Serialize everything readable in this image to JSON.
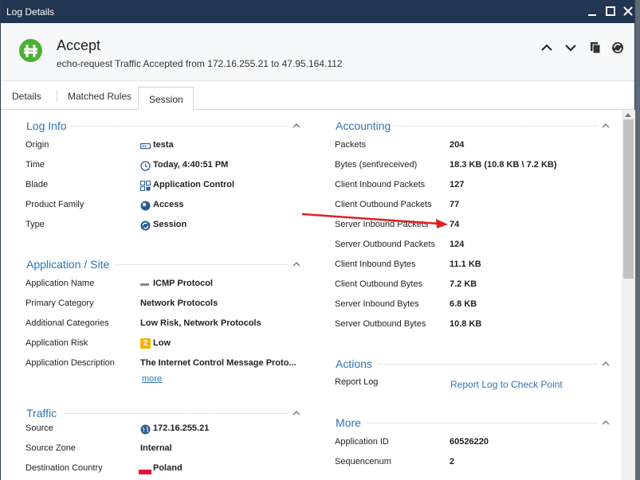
{
  "window": {
    "title": "Log Details"
  },
  "header": {
    "title": "Accept",
    "subtitle": "echo-request Traffic Accepted from 172.16.255.21 to 47.95.164.112"
  },
  "tabs": [
    {
      "label": "Details"
    },
    {
      "label": "Matched Rules"
    },
    {
      "label": "Session"
    }
  ],
  "log_info": {
    "title": "Log Info",
    "rows": [
      {
        "label": "Origin",
        "value": "testa"
      },
      {
        "label": "Time",
        "value": "Today, 4:40:51 PM"
      },
      {
        "label": "Blade",
        "value": "Application Control"
      },
      {
        "label": "Product Family",
        "value": "Access"
      },
      {
        "label": "Type",
        "value": "Session"
      }
    ]
  },
  "application": {
    "title": "Application / Site",
    "rows": [
      {
        "label": "Application Name",
        "value": "ICMP Protocol"
      },
      {
        "label": "Primary Category",
        "value": "Network Protocols"
      },
      {
        "label": "Additional Categories",
        "value": "Low Risk, Network Protocols"
      },
      {
        "label": "Application Risk",
        "value": "Low",
        "badge": "2"
      },
      {
        "label": "Application Description",
        "value": "The Internet Control Message Proto..."
      }
    ],
    "more_link": "more"
  },
  "traffic": {
    "title": "Traffic",
    "rows": [
      {
        "label": "Source",
        "value": "172.16.255.21"
      },
      {
        "label": "Source Zone",
        "value": "Internal"
      },
      {
        "label": "Destination Country",
        "value": "Poland"
      }
    ]
  },
  "accounting": {
    "title": "Accounting",
    "rows": [
      {
        "label": "Packets",
        "value": "204"
      },
      {
        "label": "Bytes (sent\\received)",
        "value": "18.3 KB (10.8 KB \\ 7.2 KB)"
      },
      {
        "label": "Client Inbound Packets",
        "value": "127"
      },
      {
        "label": "Client Outbound Packets",
        "value": "77"
      },
      {
        "label": "Server Inbound Packets",
        "value": "74"
      },
      {
        "label": "Server Outbound Packets",
        "value": "124"
      },
      {
        "label": "Client Inbound Bytes",
        "value": "11.1 KB"
      },
      {
        "label": "Client Outbound Bytes",
        "value": "7.2 KB"
      },
      {
        "label": "Server Inbound Bytes",
        "value": "6.8 KB"
      },
      {
        "label": "Server Outbound Bytes",
        "value": "10.8 KB"
      }
    ]
  },
  "actions": {
    "title": "Actions",
    "rows": [
      {
        "label": "Report Log",
        "link": "Report Log to Check Point"
      }
    ]
  },
  "more": {
    "title": "More",
    "rows": [
      {
        "label": "Application ID",
        "value": "60526220"
      },
      {
        "label": "Sequencenum",
        "value": "2"
      }
    ]
  },
  "colors": {
    "titlebar": "#223551",
    "accent": "#2f73b6",
    "accept_green": "#4caf35",
    "annotation_red": "#e02020",
    "risk_badge": "#f5b400"
  },
  "icons": {
    "window_minimize": "minimize-icon",
    "window_maximize": "maximize-icon",
    "window_close": "close-icon",
    "status": "accept-icon",
    "up": "chevron-up-icon",
    "down": "chevron-down-icon",
    "copy": "copy-icon",
    "more": "more-icon"
  }
}
